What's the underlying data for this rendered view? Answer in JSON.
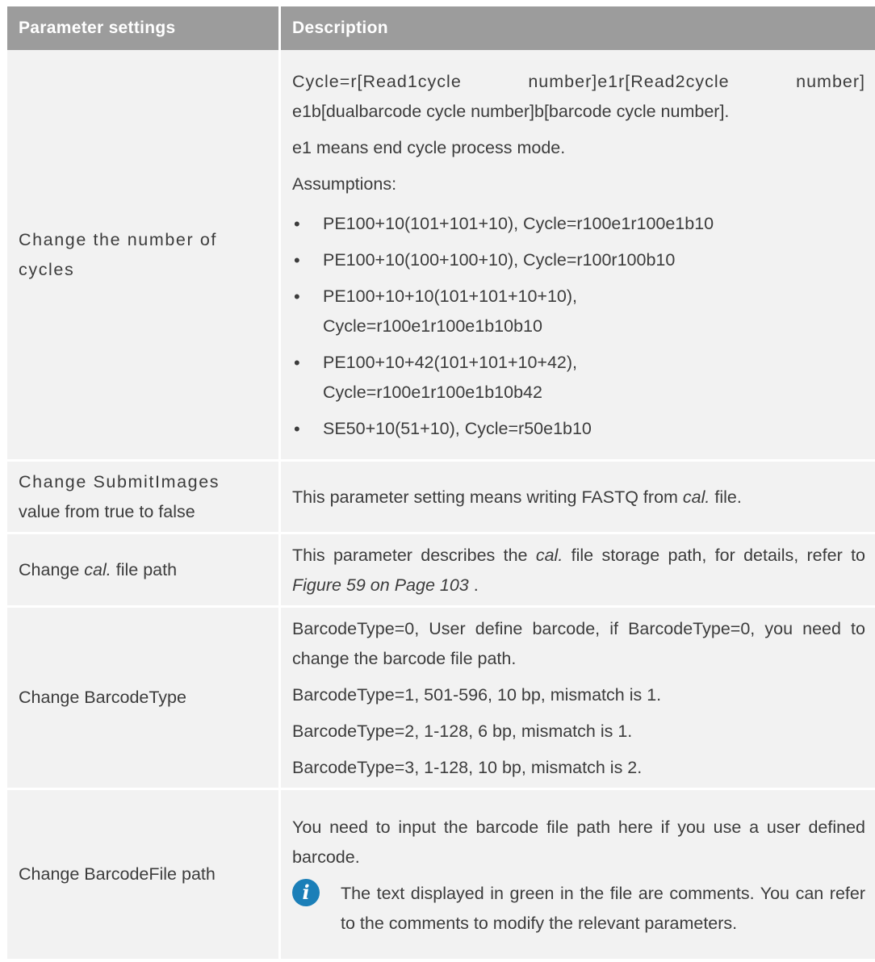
{
  "header": {
    "col1": "Parameter settings",
    "col2": "Description"
  },
  "rows": {
    "cycles": {
      "label": "Change the number of cycles",
      "desc1": "Cycle=r[Read1cycle number]e1r[Read2cycle number]",
      "desc2": "e1b[dualbarcode cycle number]b[barcode cycle number].",
      "desc3": "e1 means end cycle process mode.",
      "desc4": "Assumptions:",
      "bullets": {
        "b1": "PE100+10(101+101+10), Cycle=r100e1r100e1b10",
        "b2": "PE100+10(100+100+10), Cycle=r100r100b10",
        "b3a": "PE100+10+10(101+101+10+10),",
        "b3b": "Cycle=r100e1r100e1b10b10",
        "b4a": "PE100+10+42(101+101+10+42),",
        "b4b": "Cycle=r100e1r100e1b10b42",
        "b5": "SE50+10(51+10), Cycle=r50e1b10"
      }
    },
    "submit": {
      "label1": "Change SubmitImages",
      "label2": "value from true to false",
      "desc_a": "This parameter setting means writing FASTQ from ",
      "desc_i": "cal.",
      "desc_b": " file."
    },
    "calpath": {
      "label_a": "Change ",
      "label_i": "cal.",
      "label_b": " file path",
      "desc_a": "This parameter describes the ",
      "desc_i": "cal.",
      "desc_b": " file storage path, for details, refer to ",
      "desc_ref": "Figure 59 on Page 103",
      "desc_c": " ."
    },
    "barcodetype": {
      "label": "Change BarcodeType",
      "d1": "BarcodeType=0, User define barcode, if BarcodeType=0, you need to change the barcode file path.",
      "d2": "BarcodeType=1, 501-596, 10 bp, mismatch is 1.",
      "d3": "BarcodeType=2, 1-128, 6 bp, mismatch is 1.",
      "d4": "BarcodeType=3, 1-128, 10 bp, mismatch is 2."
    },
    "barcodefile": {
      "label": "Change BarcodeFile path",
      "d1": "You need to input the barcode file path here if you use a user defined barcode.",
      "note": "The text displayed in green in the file are comments. You can refer to the comments to modify the relevant parameters.",
      "note_icon": "info-icon"
    }
  },
  "bullet_glyph": "•"
}
